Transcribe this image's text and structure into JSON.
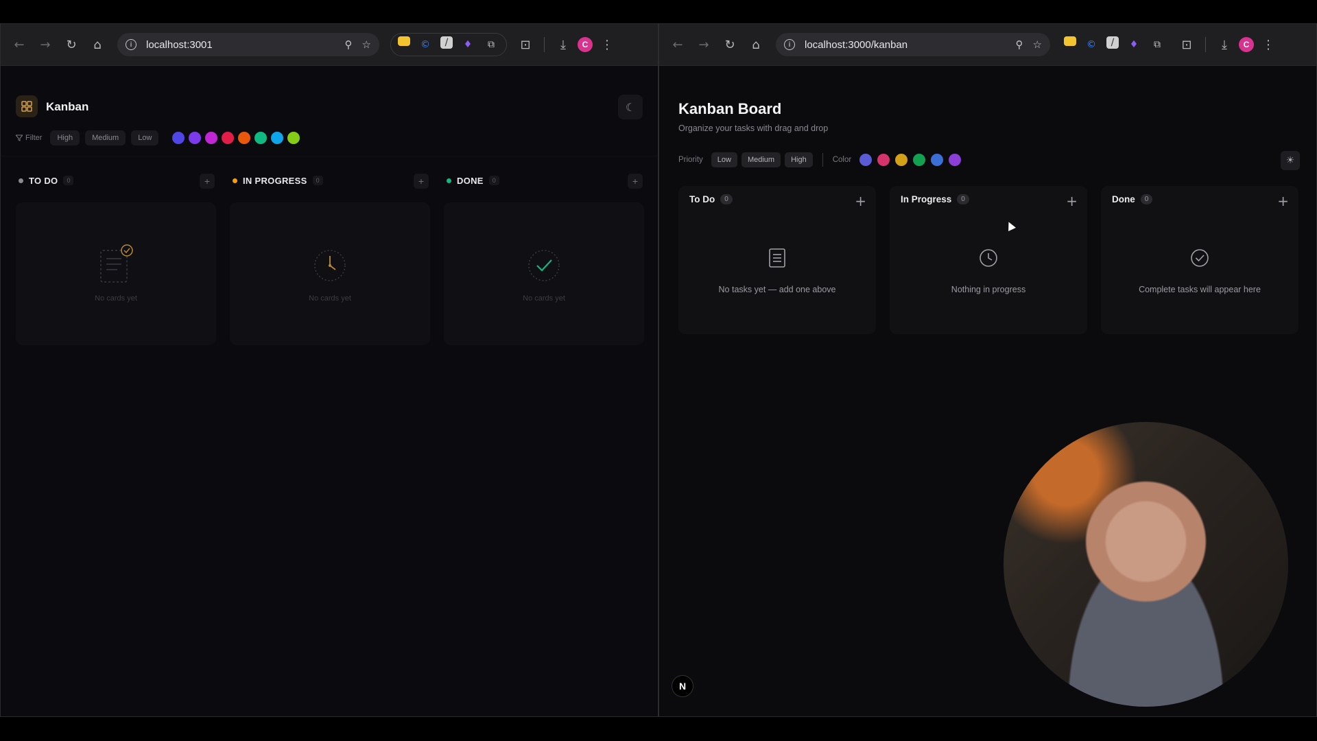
{
  "left_browser": {
    "url": "localhost:3001",
    "app": {
      "title": "Kanban",
      "filter_label": "Filter",
      "priority_chips": [
        "High",
        "Medium",
        "Low"
      ],
      "color_swatches": [
        "#4f46e5",
        "#7c3aed",
        "#c026d3",
        "#e11d48",
        "#ea580c",
        "#10b981",
        "#0ea5e9",
        "#84cc16"
      ],
      "columns": [
        {
          "title": "TO DO",
          "count": "0",
          "dot_color": "#8a8a90",
          "empty": "No cards yet",
          "icon": "clipboard-check-icon"
        },
        {
          "title": "IN PROGRESS",
          "count": "0",
          "dot_color": "#f59e0b",
          "empty": "No cards yet",
          "icon": "clock-icon"
        },
        {
          "title": "DONE",
          "count": "0",
          "dot_color": "#10b981",
          "empty": "No cards yet",
          "icon": "check-circle-icon"
        }
      ]
    }
  },
  "right_browser": {
    "url": "localhost:3000/kanban",
    "app": {
      "title": "Kanban Board",
      "subtitle": "Organize your tasks with drag and drop",
      "priority_label": "Priority",
      "priority_chips": [
        "Low",
        "Medium",
        "High"
      ],
      "color_label": "Color",
      "color_swatches": [
        "#5b5bd6",
        "#d6336c",
        "#d4a017",
        "#12a150",
        "#3b6fd6",
        "#8b3fd6"
      ],
      "columns": [
        {
          "title": "To Do",
          "count": "0",
          "empty": "No tasks yet — add one above",
          "icon": "document-icon"
        },
        {
          "title": "In Progress",
          "count": "0",
          "empty": "Nothing in progress",
          "icon": "clock-icon"
        },
        {
          "title": "Done",
          "count": "0",
          "empty": "Complete tasks will appear here",
          "icon": "check-circle-icon"
        }
      ],
      "badge": "N"
    }
  },
  "profile_initial": "C"
}
